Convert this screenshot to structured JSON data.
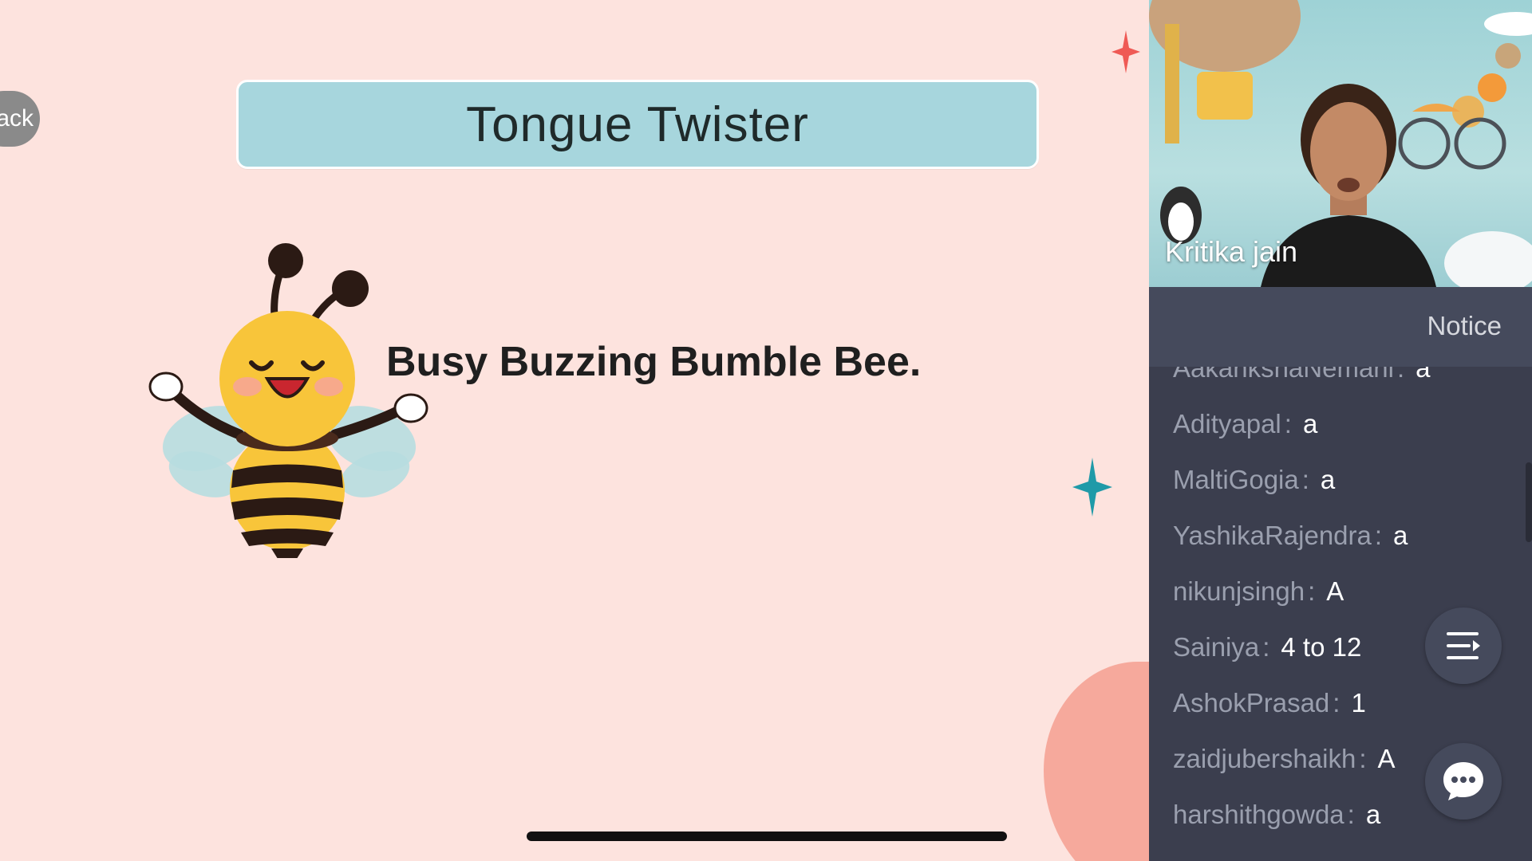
{
  "slide": {
    "back_label": "ack",
    "title": "Tongue Twister",
    "twister": "Busy Buzzing Bumble Bee."
  },
  "video": {
    "participant_name": "Kritika jain"
  },
  "chat": {
    "notice_label": "Notice",
    "separator": ":",
    "messages": [
      {
        "user": "AakankshaNemani",
        "text": "a"
      },
      {
        "user": "Adityapal",
        "text": "a"
      },
      {
        "user": "MaltiGogia",
        "text": "a"
      },
      {
        "user": "YashikaRajendra",
        "text": "a"
      },
      {
        "user": "nikunjsingh",
        "text": "A"
      },
      {
        "user": "Sainiya",
        "text": "4 to 12"
      },
      {
        "user": "AshokPrasad",
        "text": "1"
      },
      {
        "user": "zaidjubershaikh",
        "text": "A"
      },
      {
        "user": "harshithgowda",
        "text": "a"
      }
    ]
  },
  "icons": {
    "menu": "menu-icon",
    "chat": "chat-bubble-icon"
  },
  "colors": {
    "slide_background": "#fde3de",
    "title_banner": "#a7d6dd",
    "panel_background": "#3b3e4e",
    "notice_bar": "#454a5c",
    "chat_username": "#9a9fae",
    "chat_message": "#ffffff"
  }
}
